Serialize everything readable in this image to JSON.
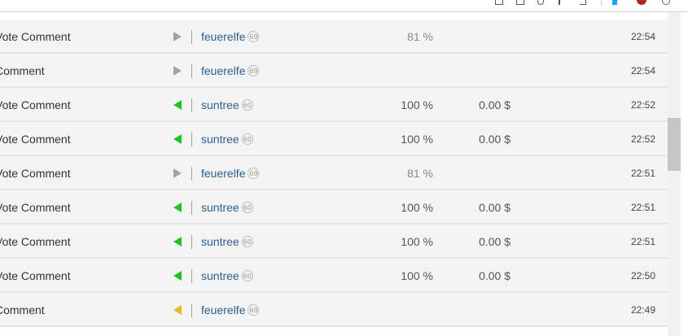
{
  "feed": {
    "rows": [
      {
        "operation": "Vote Comment",
        "direction": "right",
        "arrow_color": "#a3a3a3",
        "user": "feuerelfe",
        "reputation": "69",
        "weight": "81 %",
        "weight_dim": true,
        "value": "",
        "time": "22:54"
      },
      {
        "operation": "Comment",
        "direction": "right",
        "arrow_color": "#a3a3a3",
        "user": "feuerelfe",
        "reputation": "69",
        "weight": "",
        "weight_dim": false,
        "value": "",
        "time": "22:54"
      },
      {
        "operation": "Vote Comment",
        "direction": "left",
        "arrow_color": "#1ec41e",
        "user": "suntree",
        "reputation": "60",
        "weight": "100 %",
        "weight_dim": false,
        "value": "0.00 $",
        "time": "22:52"
      },
      {
        "operation": "Vote Comment",
        "direction": "left",
        "arrow_color": "#1ec41e",
        "user": "suntree",
        "reputation": "60",
        "weight": "100 %",
        "weight_dim": false,
        "value": "0.00 $",
        "time": "22:52"
      },
      {
        "operation": "Vote Comment",
        "direction": "right",
        "arrow_color": "#a3a3a3",
        "user": "feuerelfe",
        "reputation": "69",
        "weight": "81 %",
        "weight_dim": true,
        "value": "",
        "time": "22:51"
      },
      {
        "operation": "Vote Comment",
        "direction": "left",
        "arrow_color": "#1ec41e",
        "user": "suntree",
        "reputation": "60",
        "weight": "100 %",
        "weight_dim": false,
        "value": "0.00 $",
        "time": "22:51"
      },
      {
        "operation": "Vote Comment",
        "direction": "left",
        "arrow_color": "#1ec41e",
        "user": "suntree",
        "reputation": "60",
        "weight": "100 %",
        "weight_dim": false,
        "value": "0.00 $",
        "time": "22:51"
      },
      {
        "operation": "Vote Comment",
        "direction": "left",
        "arrow_color": "#1ec41e",
        "user": "suntree",
        "reputation": "60",
        "weight": "100 %",
        "weight_dim": false,
        "value": "0.00 $",
        "time": "22:50"
      },
      {
        "operation": "Comment",
        "direction": "left",
        "arrow_color": "#f0b429",
        "user": "feuerelfe",
        "reputation": "69",
        "weight": "",
        "weight_dim": false,
        "value": "",
        "time": "22:49"
      }
    ]
  },
  "toolbar": {
    "icons": [
      {
        "name": "save-icon",
        "color": "#555555"
      },
      {
        "name": "document-icon",
        "color": "#555555"
      },
      {
        "name": "shield-icon",
        "color": "#555555"
      },
      {
        "name": "pen-icon",
        "color": "#555555"
      },
      {
        "name": "bookmark-icon",
        "color": "#555555"
      },
      {
        "name": "extension-icon",
        "color": "#1da1f2"
      },
      {
        "name": "record-icon",
        "color": "#b3261e"
      },
      {
        "name": "puzzle-icon",
        "color": "#666666"
      }
    ]
  }
}
